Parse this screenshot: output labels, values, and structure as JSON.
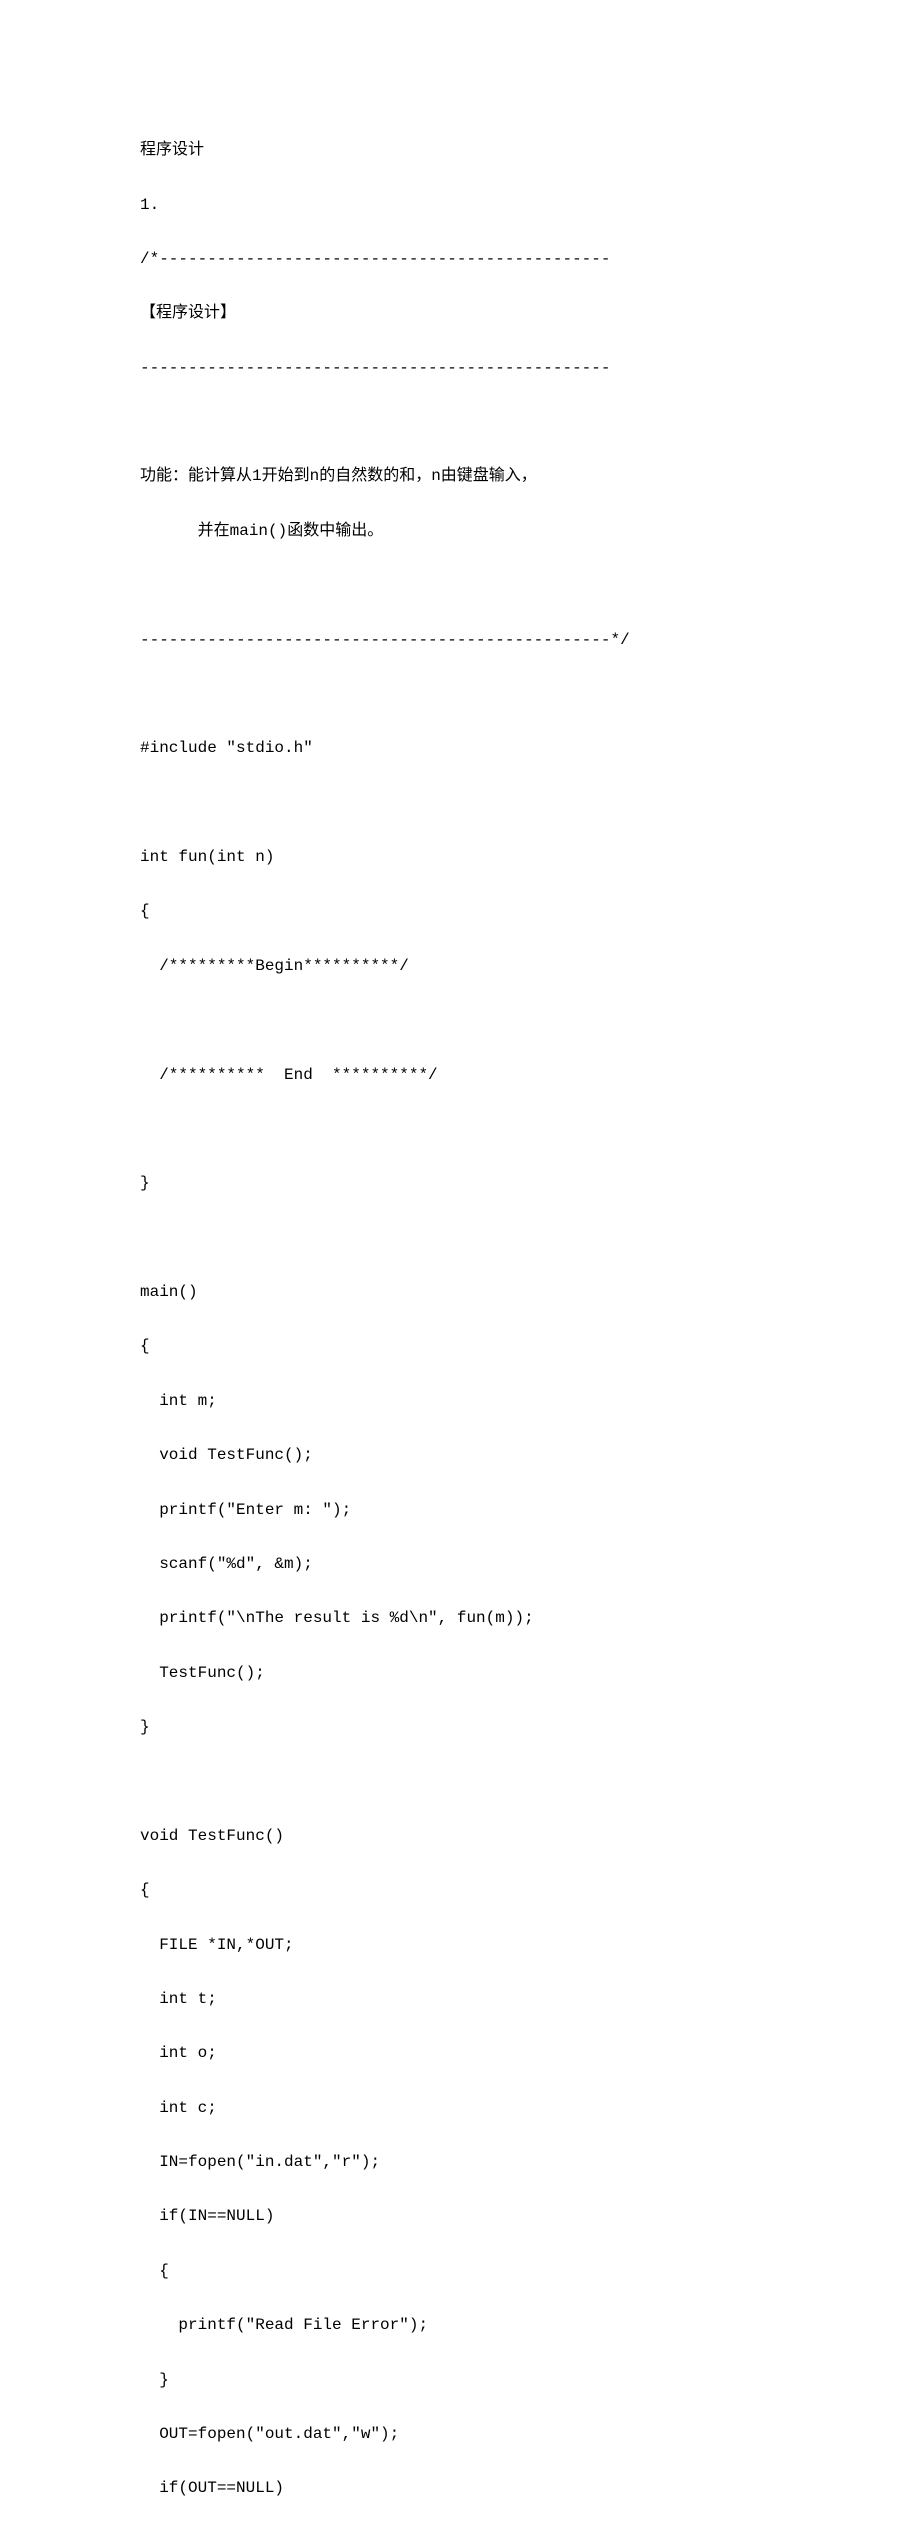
{
  "document": {
    "lines": [
      "程序设计",
      "1.",
      "/*-----------------------------------------------",
      "【程序设计】",
      "-------------------------------------------------",
      "",
      "功能：能计算从1开始到n的自然数的和，n由键盘输入，",
      "      并在main()函数中输出。",
      "",
      "-------------------------------------------------*/",
      "",
      "#include \"stdio.h\"",
      "",
      "int fun(int n)",
      "{",
      "  /*********Begin**********/",
      "",
      "  /**********  End  **********/",
      "",
      "}",
      "",
      "main()",
      "{",
      "  int m;",
      "  void TestFunc();",
      "  printf(\"Enter m: \");",
      "  scanf(\"%d\", &m);",
      "  printf(\"\\nThe result is %d\\n\", fun(m));",
      "  TestFunc();",
      "}",
      "",
      "void TestFunc()",
      "{",
      "  FILE *IN,*OUT;",
      "  int t;",
      "  int o;",
      "  int c;",
      "  IN=fopen(\"in.dat\",\"r\");",
      "  if(IN==NULL)",
      "  {",
      "    printf(\"Read File Error\");",
      "  }",
      "  OUT=fopen(\"out.dat\",\"w\");",
      "  if(OUT==NULL)"
    ]
  }
}
